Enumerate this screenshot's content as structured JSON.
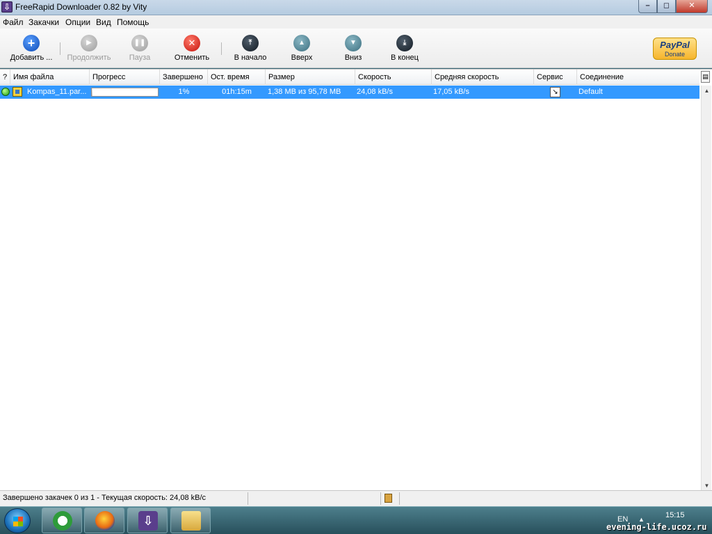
{
  "window": {
    "title": "FreeRapid Downloader 0.82 by Vity"
  },
  "menu": [
    "Файл",
    "Закачки",
    "Опции",
    "Вид",
    "Помощь"
  ],
  "toolbar": {
    "add": "Добавить ...",
    "resume": "Продолжить",
    "pause": "Пауза",
    "cancel": "Отменить",
    "to_top": "В начало",
    "up": "Вверх",
    "down": "Вниз",
    "to_bottom": "В конец"
  },
  "donate": {
    "brand": "PayPal",
    "label": "Donate"
  },
  "columns": [
    "?",
    "Имя файла",
    "Прогресс",
    "Завершено",
    "Ост. время",
    "Размер",
    "Скорость",
    "Средняя скорость",
    "Сервис",
    "Соединение"
  ],
  "rows": [
    {
      "filename": "Kompas_11.par...",
      "progress": 0.01,
      "completed": "1%",
      "remaining": "01h:15m",
      "size": "1,38 MB из 95,78 MB",
      "speed": "24,08 kB/s",
      "avg_speed": "17,05 kB/s",
      "connection": "Default"
    }
  ],
  "status": {
    "text": "Завершено закачек 0 из 1 - Текущая скорость: 24,08 kB/c"
  },
  "taskbar": {
    "lang": "EN",
    "time": "15:15",
    "watermark": "evening-life.ucoz.ru"
  }
}
